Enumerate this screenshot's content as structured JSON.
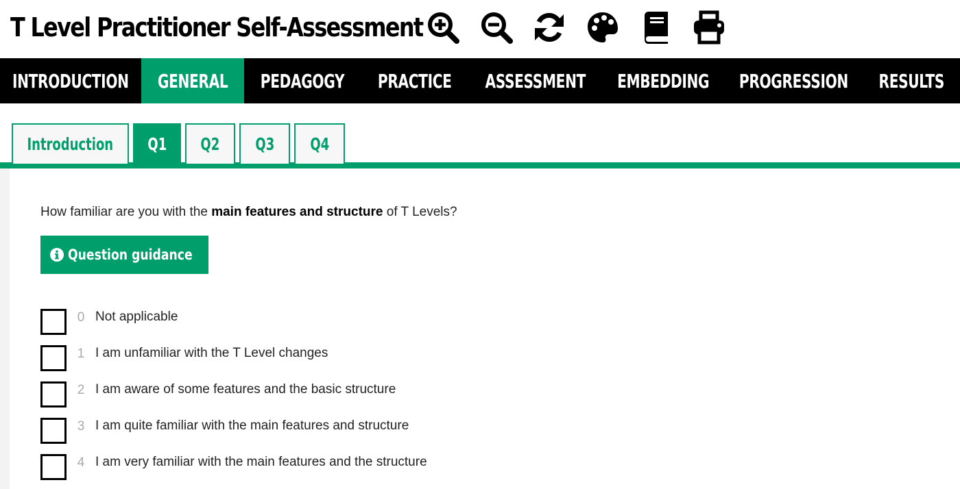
{
  "header": {
    "title": "T Level Practitioner Self-Assessment",
    "toolbar": [
      {
        "name": "zoom-in-icon"
      },
      {
        "name": "zoom-out-icon"
      },
      {
        "name": "refresh-icon"
      },
      {
        "name": "palette-icon"
      },
      {
        "name": "book-icon"
      },
      {
        "name": "print-icon"
      }
    ]
  },
  "nav": {
    "items": [
      "INTRODUCTION",
      "GENERAL",
      "PEDAGOGY",
      "PRACTICE",
      "ASSESSMENT",
      "EMBEDDING",
      "PROGRESSION",
      "RESULTS"
    ],
    "active": "GENERAL"
  },
  "subtabs": {
    "items": [
      "Introduction",
      "Q1",
      "Q2",
      "Q3",
      "Q4"
    ],
    "active": "Q1"
  },
  "question": {
    "text_before": "How familiar are you with the ",
    "text_bold": "main features and structure",
    "text_after": " of T Levels?",
    "guidance_label": "Question guidance"
  },
  "options": [
    {
      "num": "0",
      "label": "Not applicable",
      "checked": false
    },
    {
      "num": "1",
      "label": "I am unfamiliar with the T Level changes",
      "checked": false
    },
    {
      "num": "2",
      "label": "I am aware of some features and the basic structure",
      "checked": false
    },
    {
      "num": "3",
      "label": "I am quite familiar with the main features and structure",
      "checked": false
    },
    {
      "num": "4",
      "label": "I am very familiar with the main features and the structure",
      "checked": false
    }
  ],
  "colors": {
    "accent": "#009e6a",
    "nav_bg": "#000000"
  }
}
